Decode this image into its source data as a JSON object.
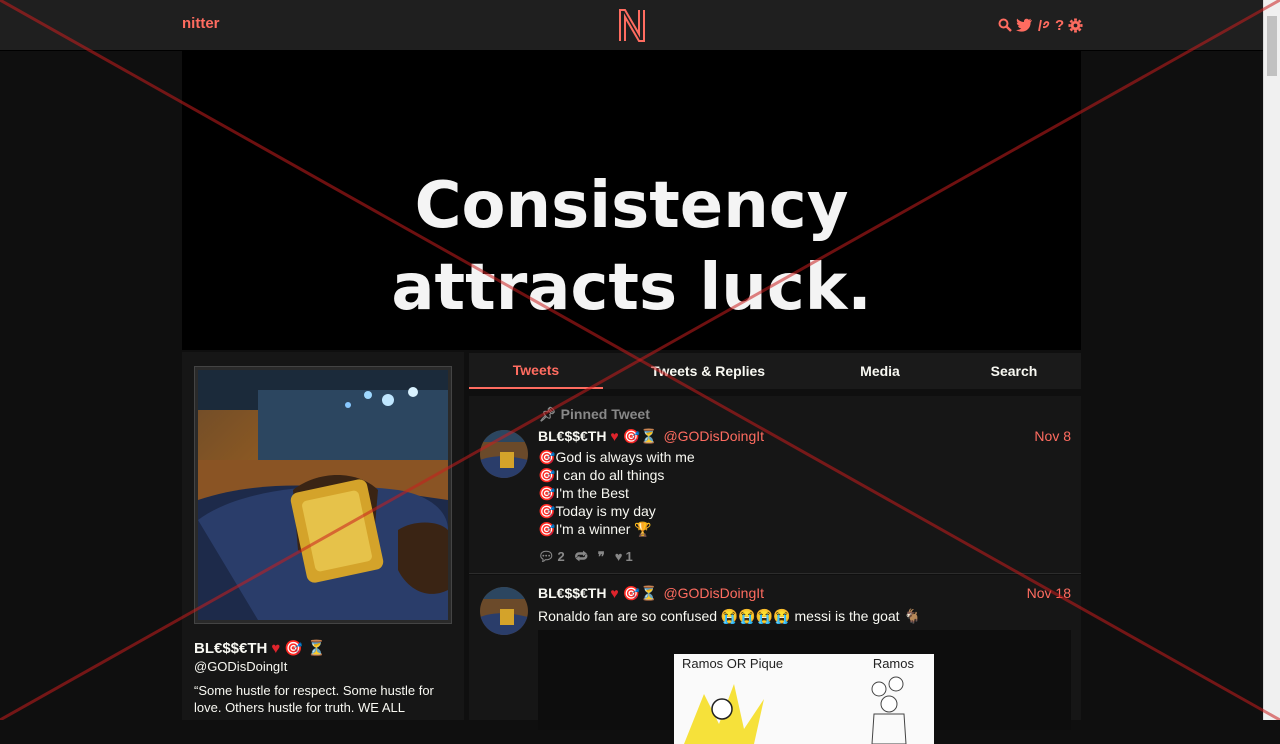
{
  "navbar": {
    "brand": "nitter",
    "icons": [
      "search-icon",
      "twitter-bird-icon",
      "rss-icon",
      "help-icon",
      "gear-icon"
    ],
    "help_label": "?"
  },
  "banner": {
    "line1": "Consistency",
    "line2": "attracts luck."
  },
  "profile": {
    "name": "BL€$$€TH",
    "handle": "@GODisDoingIt",
    "bio": "“Some hustle for respect. Some hustle for love. Others hustle for truth. WE ALL"
  },
  "tabs": [
    {
      "label": "Tweets",
      "active": true
    },
    {
      "label": "Tweets & Replies",
      "active": false
    },
    {
      "label": "Media",
      "active": false
    },
    {
      "label": "Search",
      "active": false
    }
  ],
  "tweets": [
    {
      "pinned_label": "Pinned Tweet",
      "name": "BL€$$€TH",
      "handle": "@GODisDoingIt",
      "date": "Nov 8",
      "lines": [
        "God is always with me",
        "I can do all things",
        "I'm the Best",
        "Today is my day",
        "I'm a winner"
      ],
      "replies": "2",
      "likes": "1"
    },
    {
      "name": "BL€$$€TH",
      "handle": "@GODisDoingIt",
      "date": "Nov 18",
      "text": "Ronaldo fan are so confused 😭😭😭😭 messi is the goat 🐐",
      "media_caption_left": "Ramos OR Pique",
      "media_caption_right": "Ramos"
    }
  ],
  "colors": {
    "accent": "#ff6c60",
    "background": "#0f0f0f",
    "panel": "#161616",
    "overlay_x": "#c81e1e"
  }
}
